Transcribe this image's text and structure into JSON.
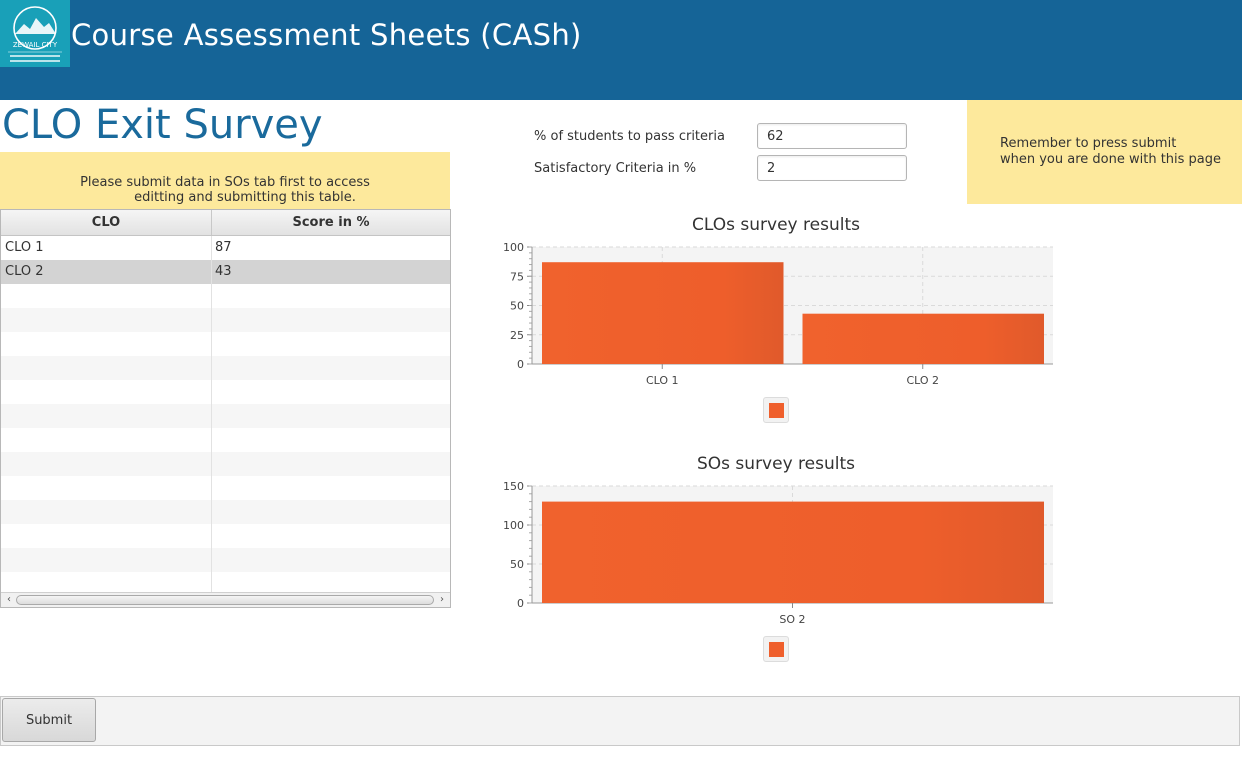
{
  "header": {
    "logo_text": "ZEWAIL CITY",
    "app_title": "Course Assessment Sheets (CASh)"
  },
  "page": {
    "title": "CLO Exit Survey"
  },
  "notes": {
    "left_line1": "Please submit data in SOs tab first to access",
    "left_line2": "editting and submitting this table.",
    "right_line1": "Remember to press submit",
    "right_line2": "when you are done with this page"
  },
  "criteria": {
    "pass_label": "% of students to pass criteria",
    "pass_value": "62",
    "satisfactory_label": "Satisfactory Criteria in %",
    "satisfactory_value": "2"
  },
  "table": {
    "columns": [
      "CLO",
      "Score in %"
    ],
    "rows": [
      [
        "CLO 1",
        "87"
      ],
      [
        "CLO 2",
        "43"
      ]
    ],
    "empty_rows": 13
  },
  "colors": {
    "header_bg": "#156497",
    "note_bg": "#fde99c",
    "bar": "#ef5f2c"
  },
  "chart_data": [
    {
      "type": "bar",
      "title": "CLOs survey results",
      "categories": [
        "CLO 1",
        "CLO 2"
      ],
      "values": [
        87,
        43
      ],
      "ylim": [
        0,
        100
      ],
      "yticks": [
        0,
        25,
        50,
        75,
        100
      ],
      "legend": "bottom",
      "grid": true
    },
    {
      "type": "bar",
      "title": "SOs survey results",
      "categories": [
        "SO 2"
      ],
      "values": [
        130
      ],
      "ylim": [
        0,
        150
      ],
      "yticks": [
        0,
        50,
        100,
        150
      ],
      "legend": "bottom",
      "grid": true
    }
  ],
  "footer": {
    "submit_label": "Submit"
  }
}
